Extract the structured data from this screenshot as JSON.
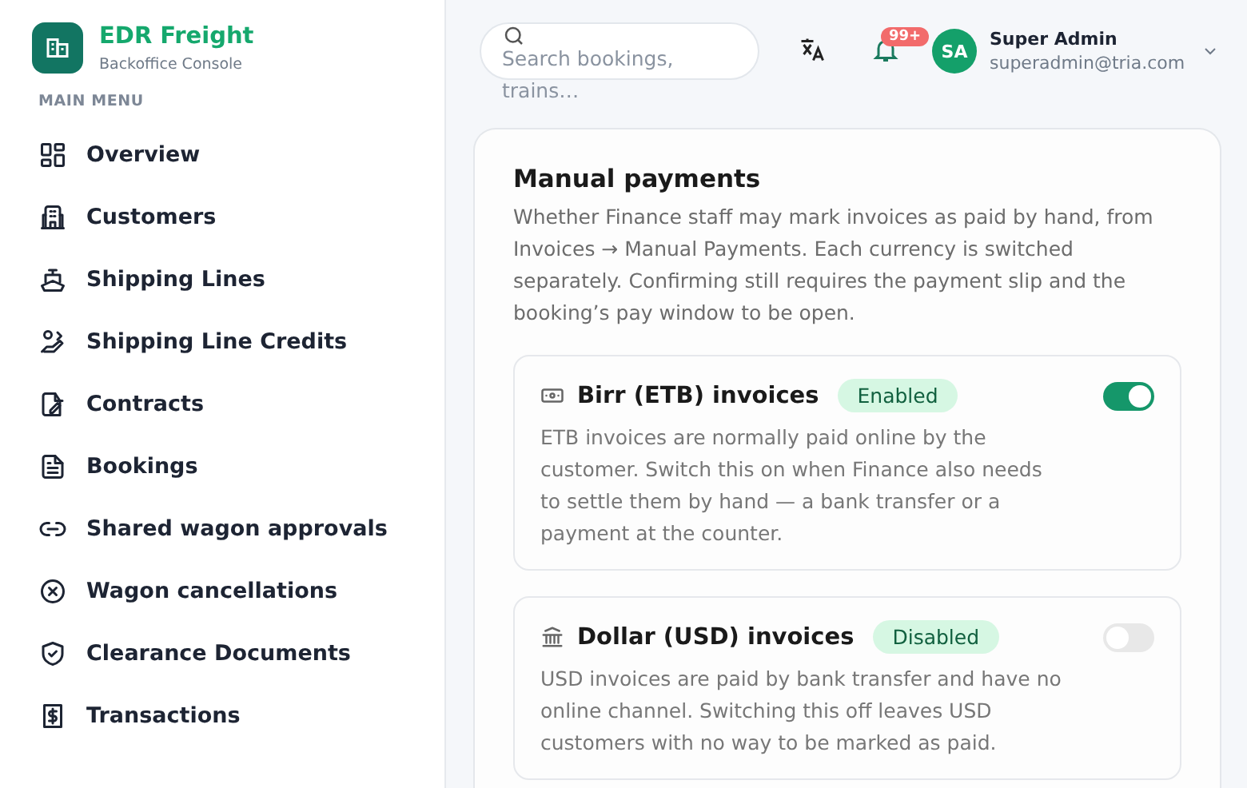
{
  "brand": {
    "name": "EDR Freight",
    "subtitle": "Backoffice Console"
  },
  "sidebar": {
    "section": "MAIN MENU",
    "items": [
      {
        "label": "Overview",
        "kind": "grid"
      },
      {
        "label": "Customers",
        "kind": "building"
      },
      {
        "label": "Shipping Lines",
        "kind": "ship"
      },
      {
        "label": "Shipping Line Credits",
        "kind": "credits"
      },
      {
        "label": "Contracts",
        "kind": "contract"
      },
      {
        "label": "Bookings",
        "kind": "file"
      },
      {
        "label": "Shared wagon approvals",
        "kind": "link"
      },
      {
        "label": "Wagon cancellations",
        "kind": "cancel"
      },
      {
        "label": "Clearance Documents",
        "kind": "shield"
      },
      {
        "label": "Transactions",
        "kind": "receipt"
      }
    ]
  },
  "header": {
    "search": {
      "placeholder": "Search bookings, trains…"
    },
    "notifications": {
      "badge": "99+"
    },
    "user": {
      "initials": "SA",
      "name": "Super Admin",
      "email": "superadmin@tria.com"
    }
  },
  "panel": {
    "title": "Manual payments",
    "description": "Whether Finance staff may mark invoices as paid by hand, from Invoices → Manual Payments. Each currency is switched separately. Confirming still requires the payment slip and the booking’s pay window to be open.",
    "currencies": [
      {
        "kind": "cash",
        "title": "Birr (ETB) invoices",
        "status": "Enabled",
        "on": true,
        "description": "ETB invoices are normally paid online by the customer. Switch this on when Finance also needs to settle them by hand — a bank transfer or a payment at the counter."
      },
      {
        "kind": "bank",
        "title": "Dollar (USD) invoices",
        "status": "Disabled",
        "on": false,
        "description": "USD invoices are paid by bank transfer and have no online channel. Switching this off leaves USD customers with no way to be marked as paid."
      }
    ]
  }
}
